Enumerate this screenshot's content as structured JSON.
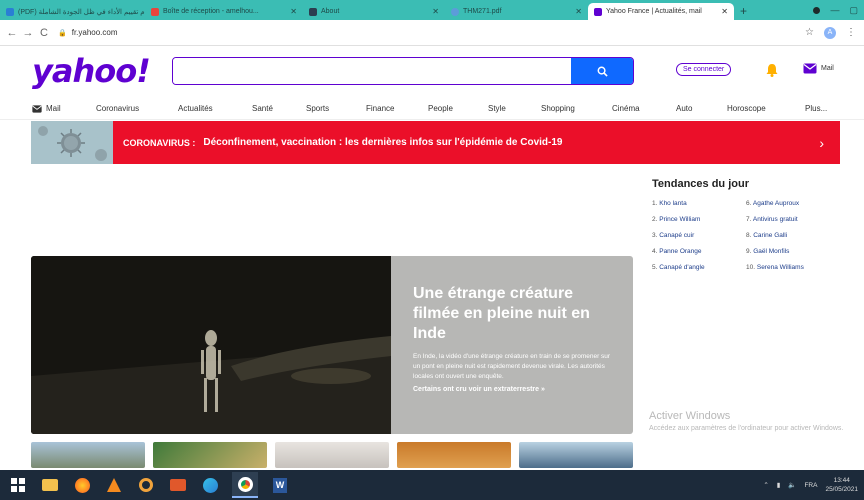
{
  "browser": {
    "tabs": [
      {
        "title": "(PDF) نظام تقييم الأداء في ظل الجودة الشاملة",
        "color": "#2a7fd4"
      },
      {
        "title": "Boîte de réception - amelhou...",
        "color": "#e8453c"
      },
      {
        "title": "About",
        "color": "#2c3e50"
      },
      {
        "title": "THM271.pdf",
        "color": "#5c9cd9"
      },
      {
        "title": "Yahoo France | Actualités, mail",
        "color": "#5f01d1"
      }
    ],
    "new_tab": "+",
    "url": "fr.yahoo.com"
  },
  "header": {
    "logo": "yahoo!",
    "search_placeholder": "",
    "signin": "Se connecter",
    "mail": "Mail"
  },
  "menu": [
    "Mail",
    "Coronavirus",
    "Actualités",
    "Santé",
    "Sports",
    "Finance",
    "People",
    "Style",
    "Shopping",
    "Cinéma",
    "Auto",
    "Horoscope",
    "Plus..."
  ],
  "banner": {
    "label": "CORONAVIRUS :",
    "message": "Déconfinement, vaccination : les dernières infos sur l'épidémie de Covid-19",
    "arrow": "›"
  },
  "trends": {
    "title": "Tendances du jour",
    "items": [
      {
        "num": "1.",
        "name": "Kho lanta"
      },
      {
        "num": "2.",
        "name": "Prince William"
      },
      {
        "num": "3.",
        "name": "Canapé cuir"
      },
      {
        "num": "4.",
        "name": "Panne Orange"
      },
      {
        "num": "5.",
        "name": "Canapé d'angle"
      },
      {
        "num": "6.",
        "name": "Agathe Auproux"
      },
      {
        "num": "7.",
        "name": "Antivirus gratuit"
      },
      {
        "num": "8.",
        "name": "Carine Galli"
      },
      {
        "num": "9.",
        "name": "Gaël Monfils"
      },
      {
        "num": "10.",
        "name": "Serena Williams"
      }
    ]
  },
  "hero": {
    "title": "Une étrange créature filmée en pleine nuit en Inde",
    "description": "En Inde, la vidéo d'une étrange créature en train de se promener sur un pont en pleine nuit est rapidement devenue virale. Les autorités locales ont ouvert une enquête.",
    "link": "Certains ont cru voir un extraterrestre »"
  },
  "windows": {
    "activate_title": "Activer Windows",
    "activate_desc": "Accédez aux paramètres de l'ordinateur pour activer Windows."
  },
  "taskbar": {
    "lang": "FRA",
    "time": "13:44",
    "date": "25/05/2021"
  },
  "colors": {
    "yahoo_purple": "#5f01d1",
    "search_blue": "#0f69ff",
    "banner_red": "#eb0f29",
    "tab_bar": "#3bbdb4"
  }
}
